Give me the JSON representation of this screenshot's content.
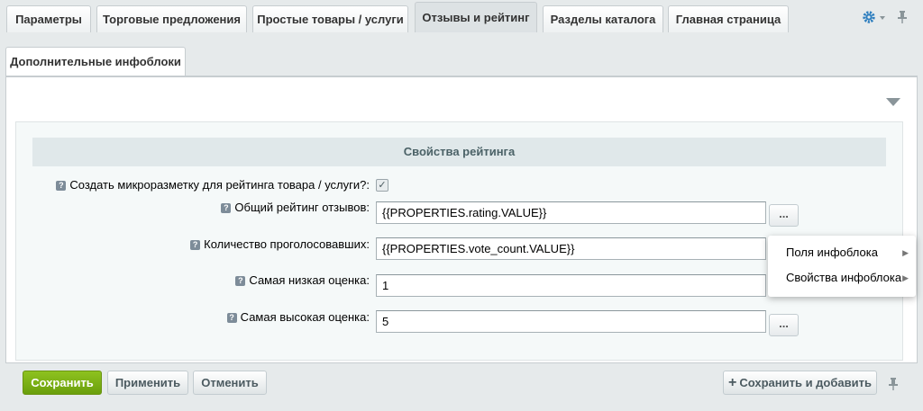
{
  "tabs": [
    {
      "label": "Параметры",
      "active": false
    },
    {
      "label": "Торговые предложения",
      "active": false
    },
    {
      "label": "Простые товары / услуги",
      "active": false
    },
    {
      "label": "Отзывы и рейтинг",
      "active": true
    },
    {
      "label": "Разделы каталога",
      "active": false
    },
    {
      "label": "Главная страница",
      "active": false
    }
  ],
  "subtab": {
    "label": "Дополнительные инфоблоки"
  },
  "section": {
    "title": "Свойства рейтинга"
  },
  "fields": {
    "microdata": {
      "label": "Создать микроразметку для рейтинга товара / услуги?:",
      "checked": true
    },
    "rating": {
      "label": "Общий рейтинг отзывов:",
      "value": "{{PROPERTIES.rating.VALUE}}"
    },
    "votes": {
      "label": "Количество проголосовавших:",
      "value": "{{PROPERTIES.vote_count.VALUE}}"
    },
    "min": {
      "label": "Самая низкая оценка:",
      "value": "1"
    },
    "max": {
      "label": "Самая высокая оценка:",
      "value": "5"
    }
  },
  "dots_label": "...",
  "help_glyph": "?",
  "check_glyph": "✓",
  "menu": {
    "items": [
      {
        "label": "Поля инфоблока",
        "arrow": "▶"
      },
      {
        "label": "Свойства инфоблока",
        "arrow": "▶"
      }
    ]
  },
  "buttons": {
    "save": "Сохранить",
    "apply": "Применить",
    "cancel": "Отменить",
    "save_add": "Сохранить и добавить",
    "save_add_icon": "+"
  },
  "colors": {
    "accent_green": "#7ab317",
    "section_text": "#4b6267"
  },
  "icons": [
    "gear-icon",
    "pin-icon",
    "collapse-triangle-icon",
    "help-icon"
  ]
}
